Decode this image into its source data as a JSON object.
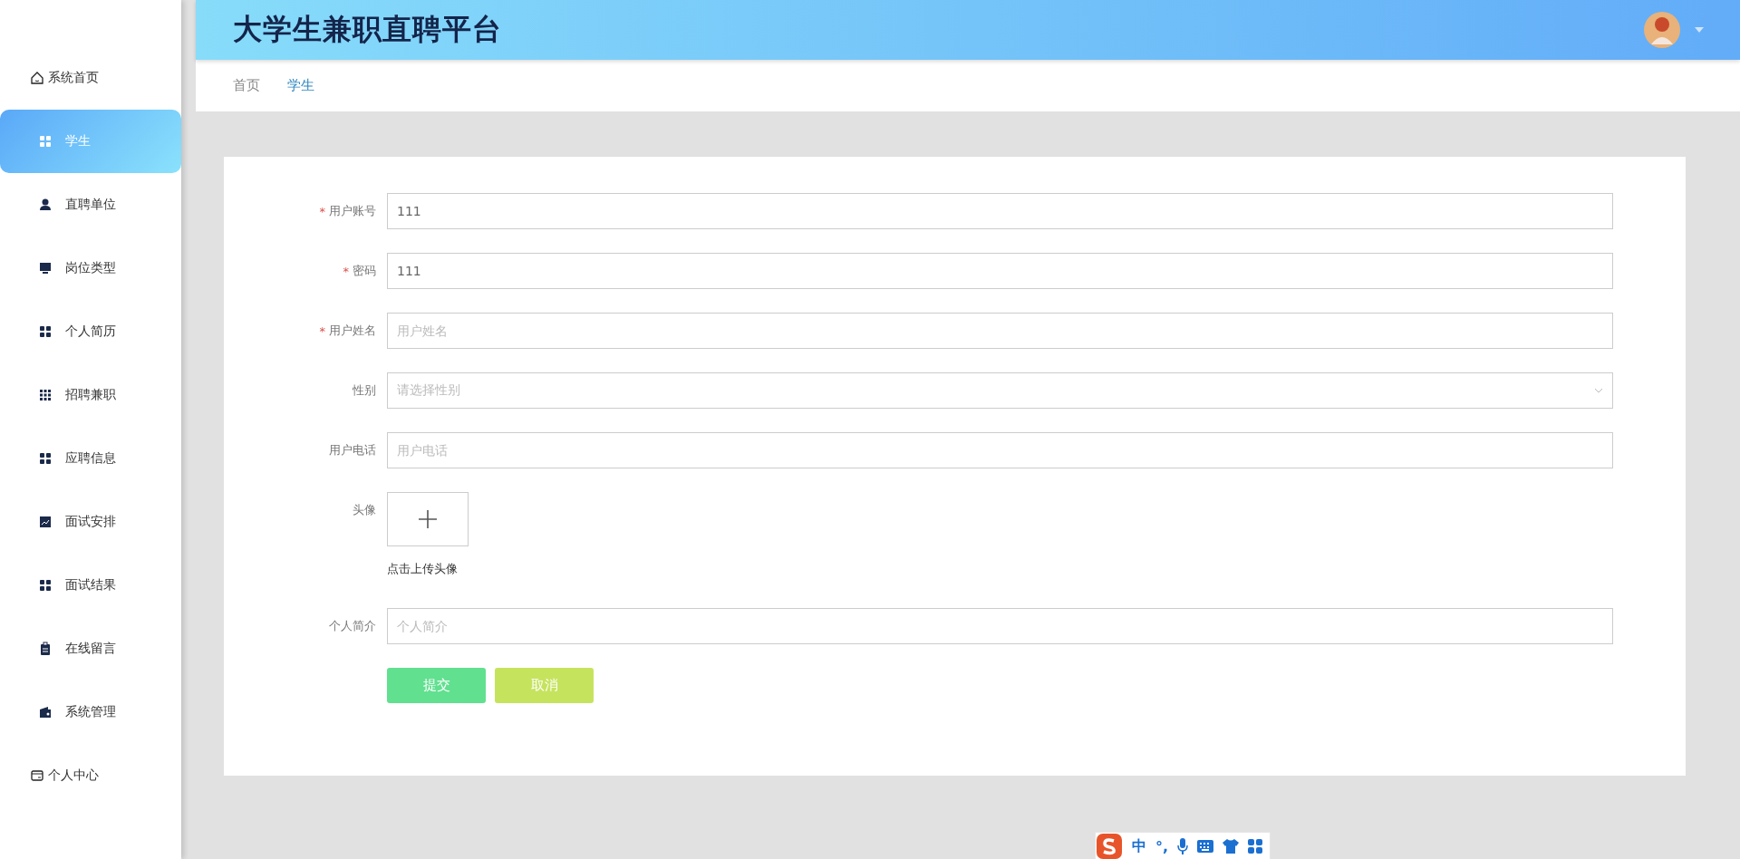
{
  "header": {
    "title": "大学生兼职直聘平台"
  },
  "sidebar": {
    "items": [
      {
        "label": "系统首页",
        "kind": "top",
        "selected": false
      },
      {
        "label": "学生",
        "kind": "sub",
        "selected": true
      },
      {
        "label": "直聘单位",
        "kind": "sub",
        "selected": false
      },
      {
        "label": "岗位类型",
        "kind": "sub",
        "selected": false
      },
      {
        "label": "个人简历",
        "kind": "sub",
        "selected": false
      },
      {
        "label": "招聘兼职",
        "kind": "sub",
        "selected": false
      },
      {
        "label": "应聘信息",
        "kind": "sub",
        "selected": false
      },
      {
        "label": "面试安排",
        "kind": "sub",
        "selected": false
      },
      {
        "label": "面试结果",
        "kind": "sub",
        "selected": false
      },
      {
        "label": "在线留言",
        "kind": "sub",
        "selected": false
      },
      {
        "label": "系统管理",
        "kind": "sub",
        "selected": false
      },
      {
        "label": "个人中心",
        "kind": "top",
        "selected": false
      }
    ]
  },
  "breadcrumb": [
    {
      "label": "首页",
      "selected": false
    },
    {
      "label": "学生",
      "selected": true
    }
  ],
  "form": {
    "fields": [
      {
        "label": "用户账号",
        "mark": "*",
        "kind": "input",
        "value": "111"
      },
      {
        "label": "密码",
        "mark": "*",
        "kind": "input",
        "value": "111"
      },
      {
        "label": "用户姓名",
        "mark": "*",
        "kind": "input",
        "placeholder": "用户姓名"
      },
      {
        "label": "性别",
        "kind": "select",
        "placeholder": "请选择性别"
      },
      {
        "label": "用户电话",
        "kind": "input",
        "placeholder": "用户电话"
      },
      {
        "label": "头像",
        "kind": "upload",
        "hint": "点击上传头像"
      },
      {
        "label": "个人简介",
        "kind": "input",
        "placeholder": "个人简介"
      }
    ],
    "buttons": [
      {
        "label": "提交",
        "kind": "submit"
      },
      {
        "label": "取消",
        "kind": "cancel"
      }
    ]
  },
  "ime_bar": {
    "texts": [
      "中",
      "°,"
    ]
  }
}
